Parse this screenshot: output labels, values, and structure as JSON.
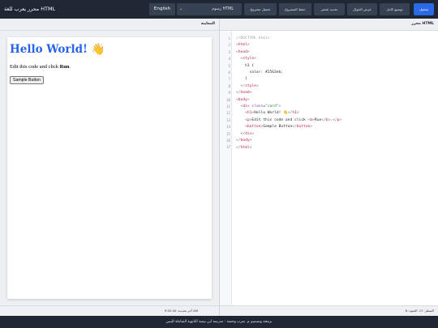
{
  "app": {
    "title": "محرر يعرب للغة HTML"
  },
  "toolbar": {
    "run": "تشغيل",
    "fullscreen": "توسيع كامل",
    "mobile_view": "عرض الجوال",
    "select_element": "تحديد عنصر",
    "save_project": "حفظ المشروع",
    "load_project": "تحميل مشروع",
    "template": "رسوم HTML",
    "language": "English"
  },
  "preview": {
    "header": "المعاينة",
    "h1": "Hello World! 👋",
    "p_prefix": "Edit this code and click ",
    "p_bold": "Run",
    "p_suffix": ".",
    "button": "Sample Button",
    "status": "آخر تحديث: 9:52:40 AM"
  },
  "editor": {
    "header": "محرر HTML",
    "status": "السطر: 17، العمود: 8",
    "line_numbers": [
      "1",
      "2",
      "3",
      "4",
      "5",
      "6",
      "7",
      "8",
      "9",
      "10",
      "11",
      "12",
      "13",
      "14",
      "15",
      "16",
      "17"
    ]
  },
  "footer": {
    "text": "برمجة وتصميم م. يعرب وحشة - مدرسة ابن تيمية الثانوية الشاملة للبنين"
  },
  "colors": {
    "topbar": "#1f2734",
    "accent": "#2b6ae6",
    "h1": "#2563eb"
  }
}
